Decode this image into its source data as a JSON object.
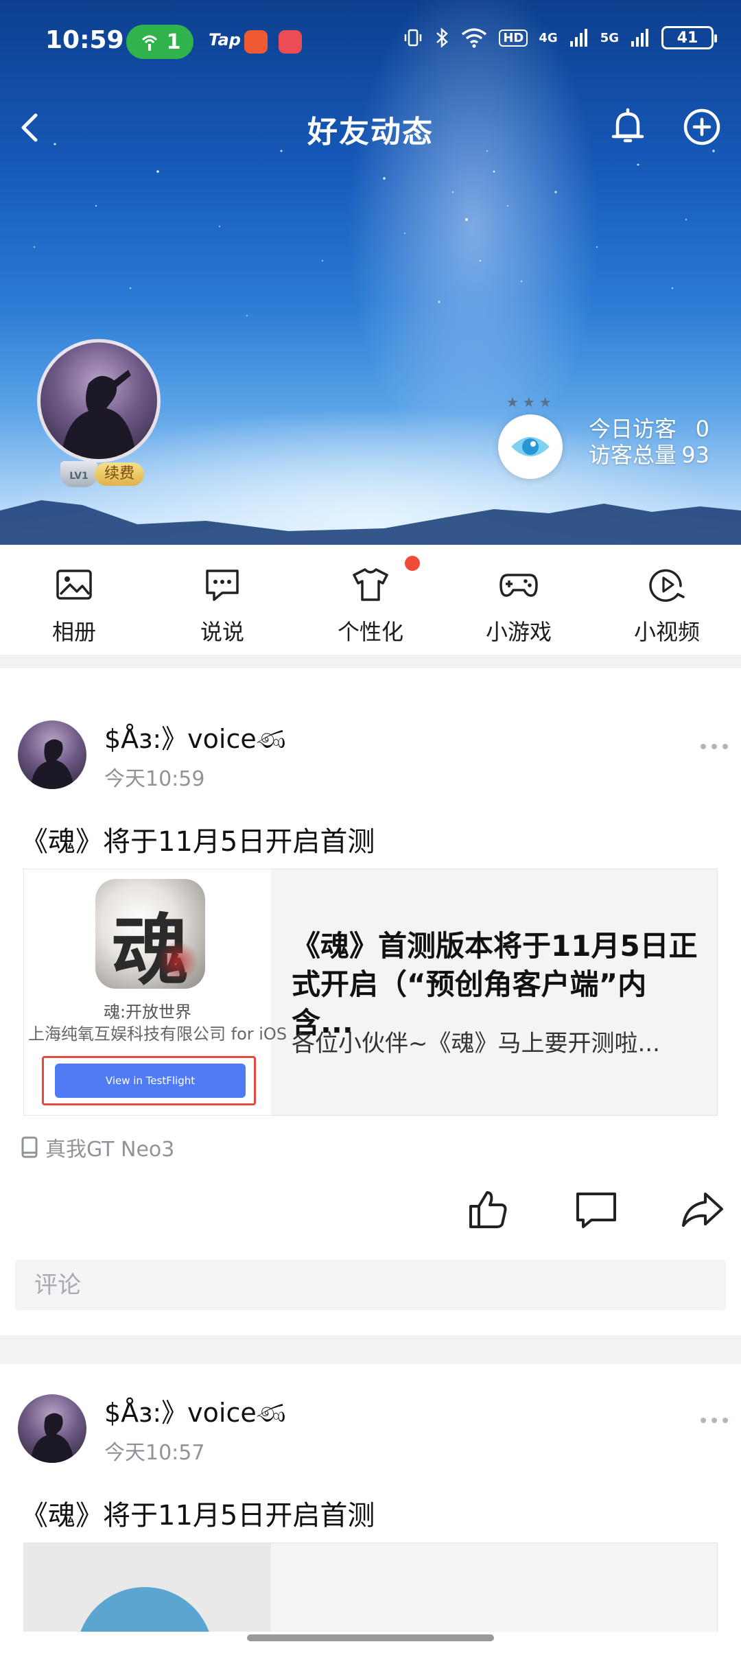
{
  "status_bar": {
    "time": "10:59",
    "hotspot_count": "1",
    "tap_label": "Tap",
    "network_5g": "5G",
    "network_4g": "4G",
    "hd_label": "HD",
    "battery": "41"
  },
  "nav": {
    "title": "好友动态"
  },
  "profile": {
    "level": "LV1",
    "renew_label": "续费",
    "visitors_today_label": "今日访客",
    "visitors_today": "0",
    "visitors_total_label": "访客总量",
    "visitors_total": "93"
  },
  "quick_nav": {
    "items": [
      {
        "label": "相册",
        "icon": "photo-album-icon"
      },
      {
        "label": "说说",
        "icon": "chat-bubble-icon"
      },
      {
        "label": "个性化",
        "icon": "tshirt-icon"
      },
      {
        "label": "小游戏",
        "icon": "gamepad-icon"
      },
      {
        "label": "小视频",
        "icon": "video-play-icon"
      }
    ]
  },
  "posts": [
    {
      "author": "$Åɜ:》voiceණ",
      "time": "今天10:59",
      "text": "《魂》将于11月5日开启首测",
      "card": {
        "thumb_glyph": "魂",
        "thumb_app_name": "魂:开放世界",
        "thumb_company": "上海纯氧互娱科技有限公司 for iOS",
        "thumb_button": "View in TestFlight",
        "title": "《魂》首测版本将于11月5日正式开启（“预创角客户端”内含...",
        "desc": "各位小伙伴~《魂》马上要开测啦..."
      },
      "device": "真我GT Neo3",
      "comment_placeholder": "评论"
    },
    {
      "author": "$Åɜ:》voiceණ",
      "time": "今天10:57",
      "text": "《魂》将于11月5日开启首测"
    }
  ],
  "colors": {
    "accent_red": "#e14a3c",
    "notify_dot": "#f04b3a",
    "testflight_blue": "#4f7cf5",
    "renew_gold": "#e0b24b",
    "hotspot_green": "#2fb34a"
  }
}
